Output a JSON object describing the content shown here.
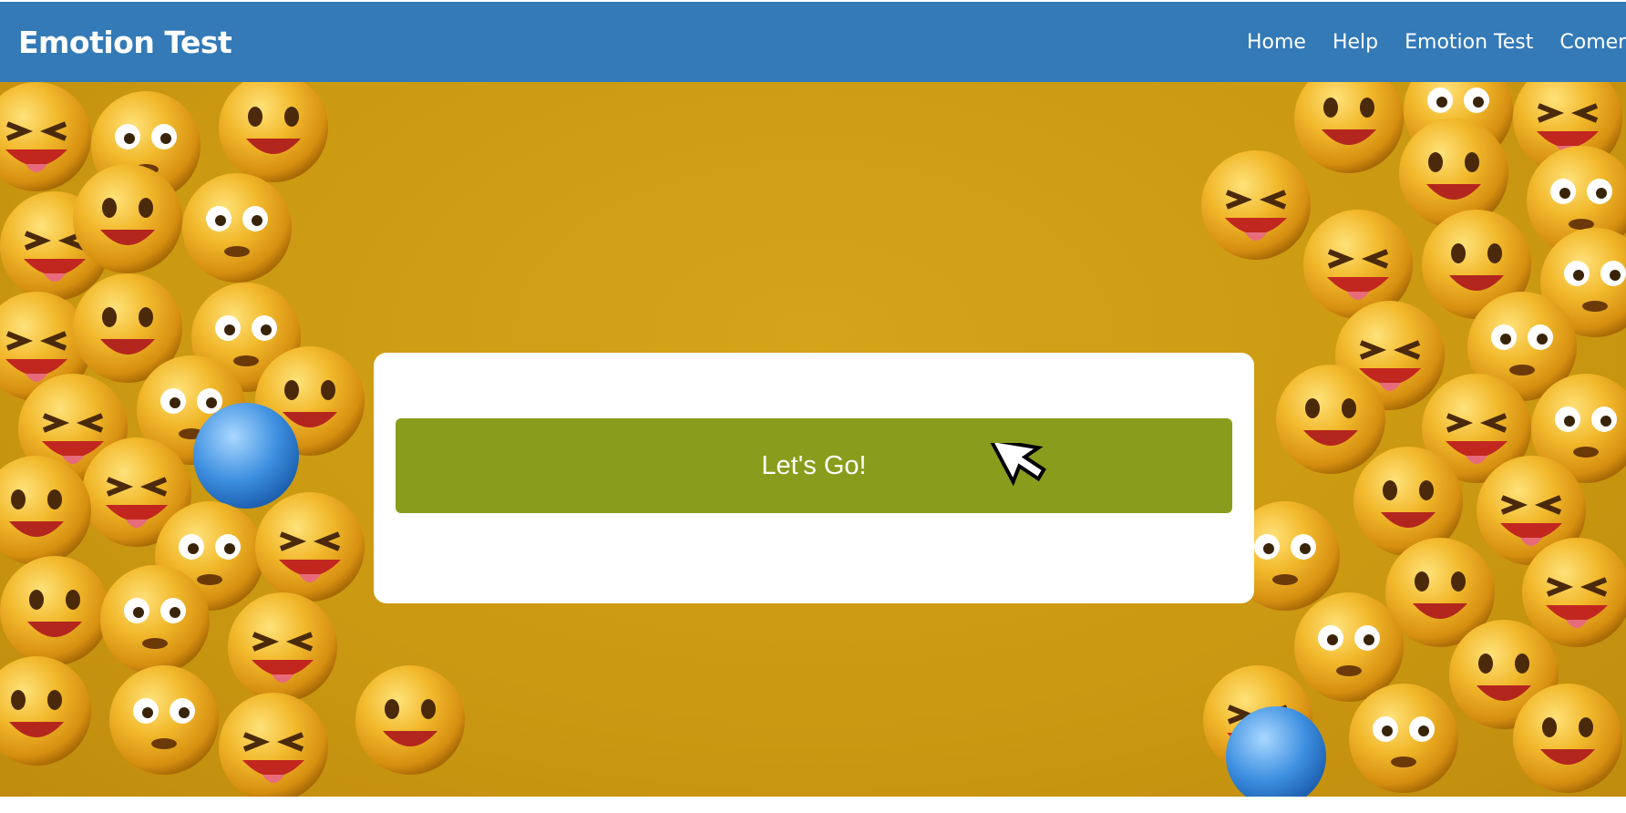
{
  "header": {
    "brand": "Emotion Test",
    "nav": [
      "Home",
      "Help",
      "Emotion Test",
      "Coment"
    ]
  },
  "card": {
    "button_label": "Let's Go!"
  },
  "colors": {
    "navbar": "#337ab7",
    "background": "#cc9a12",
    "button": "#8a9c1c",
    "card": "#ffffff"
  },
  "icons": [
    "emoji-pile-left",
    "emoji-pile-right",
    "mouse-cursor-icon"
  ]
}
